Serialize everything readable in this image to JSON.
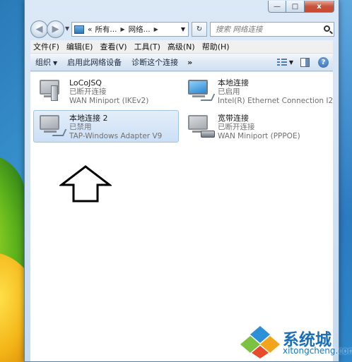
{
  "window": {
    "caption": {
      "minimize": "—",
      "maximize": "□",
      "close": "x"
    }
  },
  "address": {
    "back_icon": "back-arrow-icon",
    "forward_icon": "forward-arrow-icon",
    "breadcrumb": [
      "«",
      "所有...",
      "网络...",
      ""
    ],
    "refresh_glyph": "↻",
    "search_placeholder": "搜索 网络连接"
  },
  "menu": [
    "文件(F)",
    "编辑(E)",
    "查看(V)",
    "工具(T)",
    "高级(N)",
    "帮助(H)"
  ],
  "commands": {
    "organize": "组织",
    "enable": "启用此网络设备",
    "diagnose": "诊断这个连接",
    "more": "»",
    "help": "?"
  },
  "connections": [
    {
      "name": "LoCoJSQ",
      "status": "已断开连接",
      "adapter": "WAN Miniport (IKEv2)",
      "icon": "vpn-connection-icon"
    },
    {
      "name": "本地连接",
      "status": "已启用",
      "adapter": "Intel(R) Ethernet Connection I2...",
      "icon": "ethernet-connection-icon"
    },
    {
      "name": "本地连接 2",
      "status": "已禁用",
      "adapter": "TAP-Windows Adapter V9",
      "icon": "ethernet-disabled-icon"
    },
    {
      "name": "宽带连接",
      "status": "已断开连接",
      "adapter": "WAN Miniport (PPPOE)",
      "icon": "broadband-connection-icon"
    }
  ],
  "watermark": {
    "brand": "系统城",
    "url": "xitongcheng.com"
  },
  "colors": {
    "accent": "#1c6eb8",
    "selection": "#cbdff5",
    "status_text": "#707070"
  }
}
